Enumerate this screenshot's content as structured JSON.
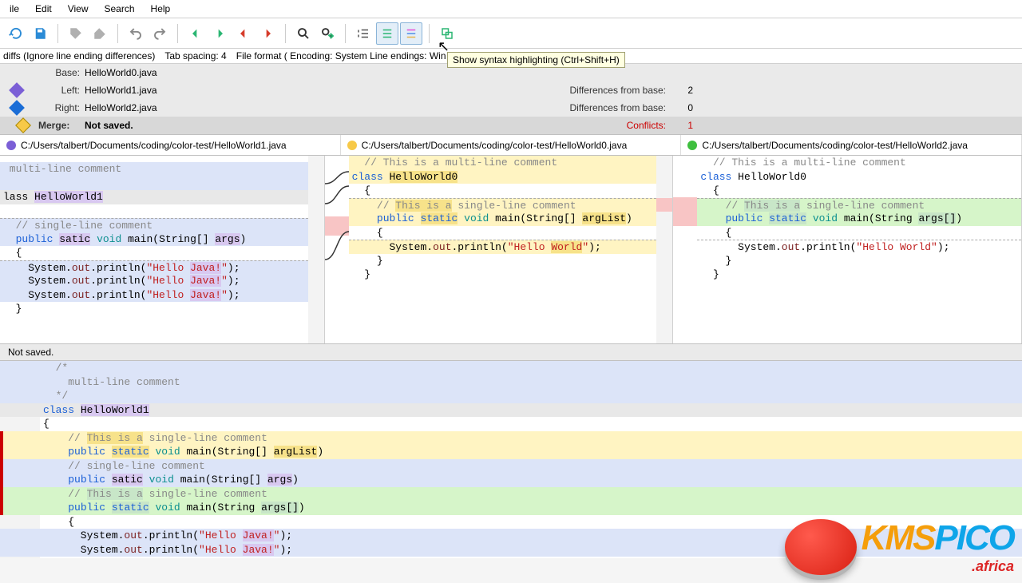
{
  "menu": {
    "file": "ile",
    "edit": "Edit",
    "view": "View",
    "search": "Search",
    "help": "Help"
  },
  "statusbar": {
    "diffs": "diffs (Ignore line ending differences)",
    "tab": "Tab spacing: 4",
    "format": "File format ( Encoding: System  Line endings: Win"
  },
  "tooltip": "Show syntax highlighting (Ctrl+Shift+H)",
  "info": {
    "base_label": "Base:",
    "base_val": "HelloWorld0.java",
    "left_label": "Left:",
    "left_val": "HelloWorld1.java",
    "right_label": "Right:",
    "right_val": "HelloWorld2.java",
    "merge_label": "Merge:",
    "merge_val": "Not saved.",
    "diff_from_base": "Differences from base:",
    "diff_left": "2",
    "diff_right": "0",
    "conflicts_label": "Conflicts:",
    "conflicts_val": "1"
  },
  "paths": {
    "left": "C:/Users/talbert/Documents/coding/color-test/HelloWorld1.java",
    "mid": "C:/Users/talbert/Documents/coding/color-test/HelloWorld0.java",
    "right": "C:/Users/talbert/Documents/coding/color-test/HelloWorld2.java"
  },
  "merge_status": "Not saved.",
  "code_left": {
    "l1": " multi-line comment",
    "l2": "",
    "l3": "lass HelloWorld1",
    "l4": "",
    "l5": "  // single-line comment",
    "l6": "  public satic void main(String[] args)",
    "l7": "  {",
    "l8": "    System.out.println(\"Hello Java!\");",
    "l9": "    System.out.println(\"Hello Java!\");",
    "l10": "    System.out.println(\"Hello Java!\");",
    "l11": "  }"
  },
  "code_mid": {
    "l1": "  // This is a multi-line comment",
    "l2": "class HelloWorld0",
    "l3": "  {",
    "l4": "    // This is a single-line comment",
    "l5": "    public static void main(String[] argList)",
    "l6": "    {",
    "l7": "      System.out.println(\"Hello World\");",
    "l8": "    }",
    "l9": "  }"
  },
  "code_right": {
    "l1": "  // This is a multi-line comment",
    "l2": "class HelloWorld0",
    "l3": "  {",
    "l4": "    // This is a single-line comment",
    "l5": "    public static void main(String args[])",
    "l6": "    {",
    "l7": "      System.out.println(\"Hello World\");",
    "l8": "    }",
    "l9": "  }"
  },
  "merge_code": {
    "l1": "  /*",
    "l2": "    multi-line comment",
    "l3": "  */",
    "l4": "class HelloWorld1",
    "l5": "{",
    "l6": "    // This is a single-line comment",
    "l7": "    public static void main(String[] argList)",
    "l8": "    // single-line comment",
    "l9": "    public satic void main(String[] args)",
    "l10": "    // This is a single-line comment",
    "l11": "    public static void main(String args[])",
    "l12": "    {",
    "l13": "      System.out.println(\"Hello Java!\");",
    "l14": "      System.out.println(\"Hello Java!\");"
  },
  "watermark": {
    "kms": "KMS",
    "pico": "PICO",
    "africa": ".africa"
  }
}
